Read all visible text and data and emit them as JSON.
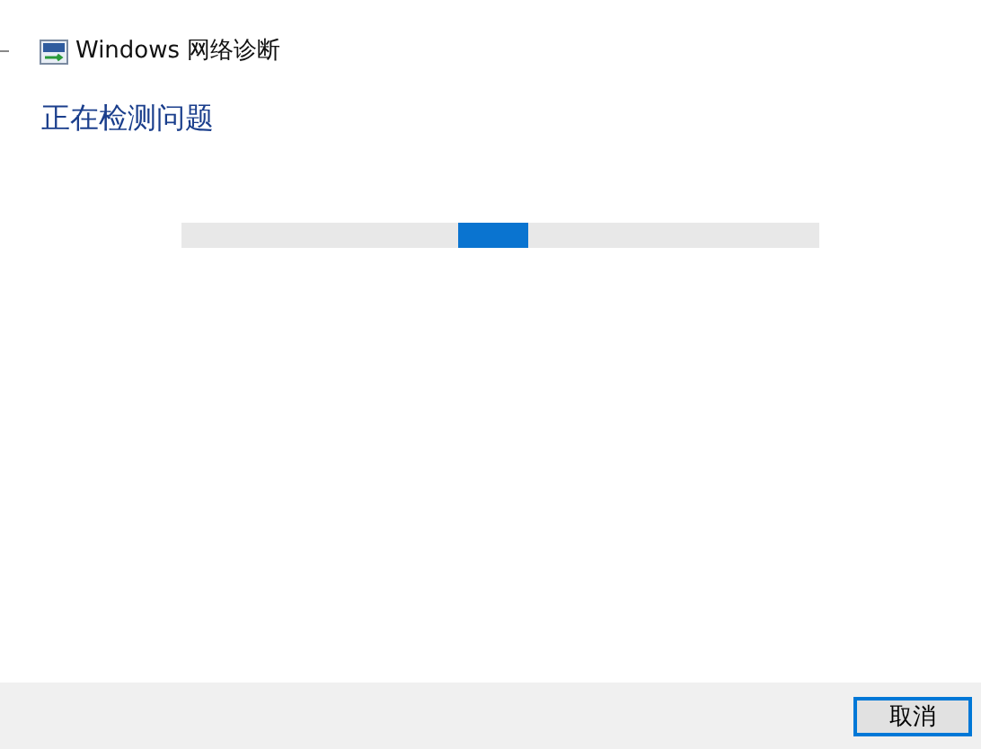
{
  "window": {
    "title": "Windows 网络诊断"
  },
  "heading": "正在检测问题",
  "progress": {
    "kind": "indeterminate"
  },
  "buttons": [
    {
      "label": "取消",
      "default": true
    }
  ]
}
